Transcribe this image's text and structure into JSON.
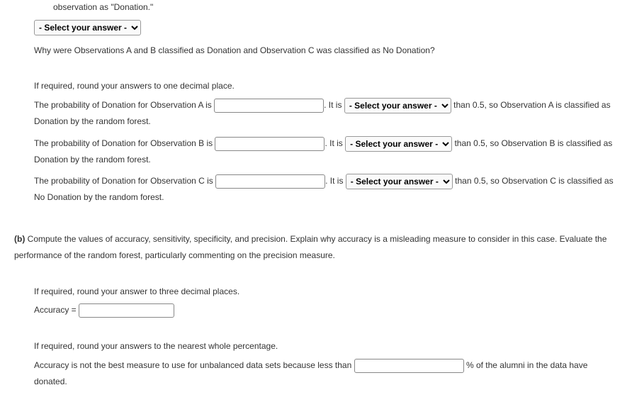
{
  "fragment": "observation as \"Donation.\"",
  "select_placeholder": "- Select your answer -",
  "question_why": "Why were Observations A and B classified as Donation and Observation C was classified as No Donation?",
  "round_one_decimal": "If required, round your answers to one decimal place.",
  "obs": {
    "a_pre": "The probability of Donation for Observation A is ",
    "a_mid": ". It is ",
    "a_post": " than 0.5, so Observation A is classified as Donation by the random forest.",
    "b_pre": "The probability of Donation for Observation B is ",
    "b_mid": ". It is ",
    "b_post": " than 0.5, so Observation B is classified as Donation by the random forest.",
    "c_pre": "The probability of Donation for Observation C is ",
    "c_mid": ". It is ",
    "c_post": " than 0.5, so Observation C is classified as No Donation by the random forest."
  },
  "partb": {
    "label": "(b)",
    "text1": "Compute the values of accuracy, sensitivity, specificity, and precision. Explain why accuracy is a misleading measure to consider in this case. Evaluate the performance of the random forest, particularly commenting on the precision measure.",
    "round_three": "If required, round your answer to three decimal places.",
    "accuracy_label": "Accuracy = ",
    "round_whole": "If required, round your answers to the nearest whole percentage.",
    "unbalanced_pre": "Accuracy is not the best measure to use for unbalanced data sets because less than ",
    "unbalanced_post": " % of the alumni in the data have donated."
  }
}
